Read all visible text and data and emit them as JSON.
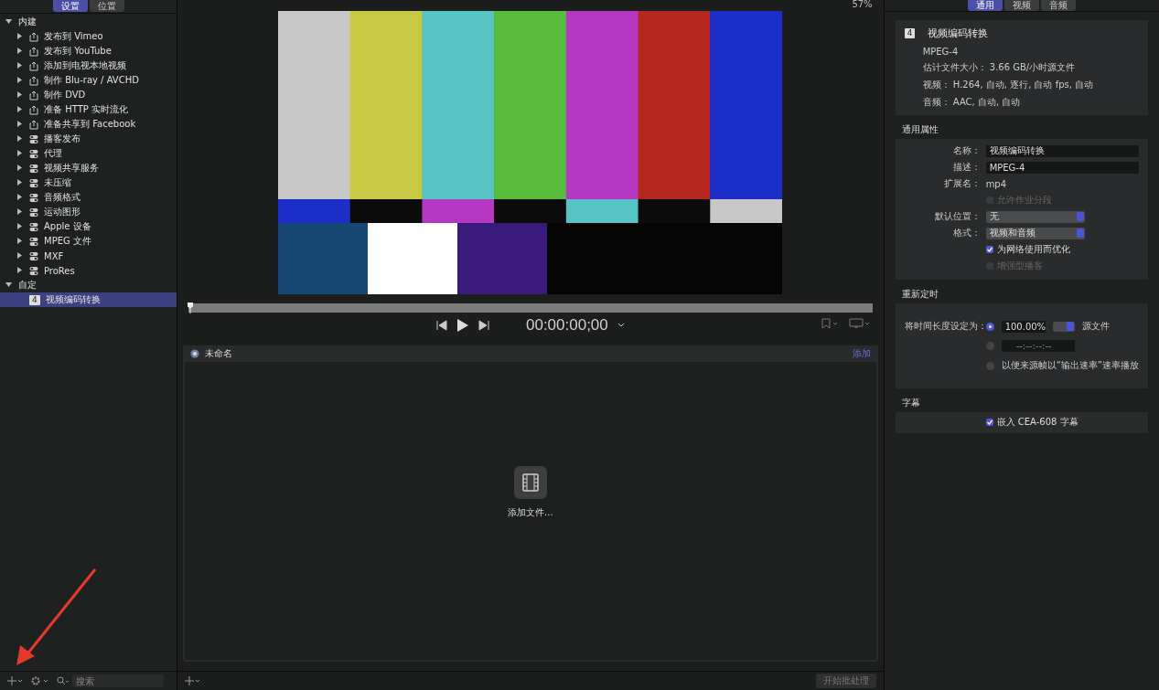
{
  "sidebar": {
    "tabs": [
      {
        "label": "设置",
        "selected": true
      },
      {
        "label": "位置",
        "selected": false
      }
    ],
    "groups": [
      {
        "label": "内建",
        "expanded": true,
        "children": [
          {
            "label": "发布到 Vimeo",
            "kind": "share",
            "expanded": false,
            "selected": false
          },
          {
            "label": "发布到 YouTube",
            "kind": "share",
            "expanded": false,
            "selected": false
          },
          {
            "label": "添加到电视本地视频",
            "kind": "share",
            "expanded": false,
            "selected": false
          },
          {
            "label": "制作 Blu-ray / AVCHD",
            "kind": "share",
            "expanded": false,
            "selected": false
          },
          {
            "label": "制作 DVD",
            "kind": "share",
            "expanded": false,
            "selected": false
          },
          {
            "label": "准备 HTTP 实时流化",
            "kind": "share",
            "expanded": false,
            "selected": false
          },
          {
            "label": "准备共享到 Facebook",
            "kind": "share",
            "expanded": false,
            "selected": false
          },
          {
            "label": "播客发布",
            "kind": "folder",
            "expanded": false,
            "selected": false
          },
          {
            "label": "代理",
            "kind": "folder",
            "expanded": false,
            "selected": false
          },
          {
            "label": "视频共享服务",
            "kind": "folder",
            "expanded": false,
            "selected": false
          },
          {
            "label": "未压缩",
            "kind": "folder",
            "expanded": false,
            "selected": false
          },
          {
            "label": "音频格式",
            "kind": "folder",
            "expanded": false,
            "selected": false
          },
          {
            "label": "运动图形",
            "kind": "folder",
            "expanded": false,
            "selected": false
          },
          {
            "label": "Apple 设备",
            "kind": "folder",
            "expanded": false,
            "selected": false
          },
          {
            "label": "MPEG 文件",
            "kind": "folder",
            "expanded": false,
            "selected": false
          },
          {
            "label": "MXF",
            "kind": "folder",
            "expanded": false,
            "selected": false
          },
          {
            "label": "ProRes",
            "kind": "folder",
            "expanded": false,
            "selected": false
          }
        ]
      },
      {
        "label": "自定",
        "expanded": true,
        "children": [
          {
            "label": "视频编码转换",
            "kind": "custom",
            "badge": "4",
            "selected": true
          }
        ]
      }
    ],
    "search": {
      "placeholder": "搜索"
    }
  },
  "viewer": {
    "zoom": "57%",
    "playhead": {
      "level": 0
    },
    "timecode": "00:00:00;00"
  },
  "batch": {
    "title": "未命名",
    "add_link": "添加",
    "drop_label": "添加文件...",
    "start_button": {
      "label": "开始批处理",
      "disabled": true
    }
  },
  "inspector": {
    "tabs": [
      {
        "label": "通用",
        "selected": true
      },
      {
        "label": "视频",
        "selected": false
      },
      {
        "label": "音频",
        "selected": false
      }
    ],
    "summary": {
      "badge": "4",
      "name": "视频编码转换",
      "format": "MPEG-4",
      "lines": [
        {
          "label": "估计文件大小：",
          "value": "3.66 GB/小时源文件"
        },
        {
          "label": "视频：",
          "value": "H.264, 自动, 逐行, 自动 fps, 自动"
        },
        {
          "label": "音频：",
          "value": "AAC, 自动, 自动"
        }
      ]
    },
    "general": {
      "title": "通用属性",
      "rows": [
        {
          "kind": "field",
          "label": "名称：",
          "value": "视频编码转换"
        },
        {
          "kind": "field",
          "label": "描述：",
          "value": "MPEG-4"
        },
        {
          "kind": "text",
          "label": "扩展名：",
          "value": "mp4"
        },
        {
          "kind": "checkbox",
          "label": "允许作业分段",
          "checked": false,
          "disabled": true
        },
        {
          "kind": "popup",
          "label": "默认位置：",
          "value": "无"
        },
        {
          "kind": "popup",
          "label": "格式：",
          "value": "视频和音频"
        },
        {
          "kind": "checkbox",
          "label": "为网络使用而优化",
          "checked": true,
          "disabled": false
        },
        {
          "kind": "checkbox",
          "label": "增强型播客",
          "checked": false,
          "disabled": true
        }
      ]
    },
    "retiming": {
      "title": "重新定时",
      "label": "将时间长度设定为：",
      "options": [
        {
          "kind": "percent",
          "selected": true,
          "value": "100.00%",
          "suffix": "源文件"
        },
        {
          "kind": "timecode",
          "selected": false,
          "value": "--:--:--:--"
        },
        {
          "kind": "label",
          "selected": false,
          "label": "以便来源帧以“输出速率”速率播放"
        }
      ]
    },
    "captions": {
      "title": "字幕",
      "checkbox": {
        "label": "嵌入 CEA-608 字幕",
        "checked": true
      }
    }
  },
  "annotation": {
    "kind": "arrow"
  }
}
